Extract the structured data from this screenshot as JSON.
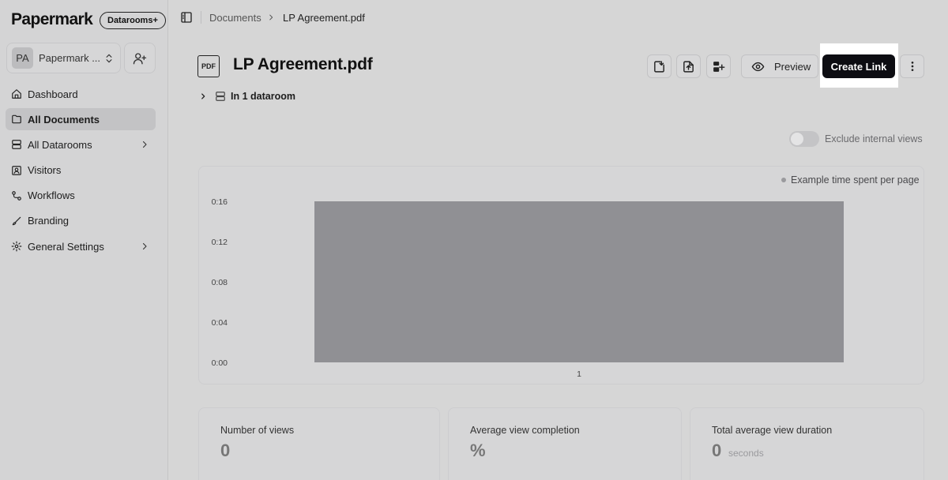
{
  "sidebar": {
    "brand": "Papermark",
    "plan_badge": "Datarooms+",
    "team": {
      "avatar_initials": "PA",
      "name": "Papermark ..."
    },
    "items": [
      {
        "label": "Dashboard",
        "icon": "home-icon"
      },
      {
        "label": "All Documents",
        "icon": "folder-icon",
        "active": true
      },
      {
        "label": "All Datarooms",
        "icon": "server-icon",
        "has_submenu": true
      },
      {
        "label": "Visitors",
        "icon": "contact-icon"
      },
      {
        "label": "Workflows",
        "icon": "workflow-icon"
      },
      {
        "label": "Branding",
        "icon": "brush-icon"
      },
      {
        "label": "General Settings",
        "icon": "settings-icon",
        "has_submenu": true
      }
    ]
  },
  "breadcrumb": {
    "parent": "Documents",
    "current": "LP Agreement.pdf"
  },
  "document": {
    "file_type_label": "PDF",
    "title": "LP Agreement.pdf",
    "dataroom_text": "In 1 dataroom"
  },
  "actions": {
    "preview_label": "Preview",
    "create_link_label": "Create Link"
  },
  "filters": {
    "exclude_internal_label": "Exclude internal views",
    "exclude_internal_on": false
  },
  "chart_data": {
    "type": "bar",
    "categories": [
      "1"
    ],
    "series": [
      {
        "name": "Example time spent per page",
        "values": [
          16
        ]
      }
    ],
    "yticks": [
      "0:00",
      "0:04",
      "0:08",
      "0:12",
      "0:16"
    ],
    "ylim": [
      0,
      16
    ],
    "bar_color": "#909094",
    "legend_position": "top-right",
    "grid": false
  },
  "stats": [
    {
      "label": "Number of views",
      "value": "0",
      "unit": ""
    },
    {
      "label": "Average view completion",
      "value": "%",
      "unit": ""
    },
    {
      "label": "Total average view duration",
      "value": "0",
      "unit": "seconds"
    }
  ],
  "colors": {
    "primary_button": "#0d0d12",
    "sidebar_active": "#c3c3c5"
  }
}
